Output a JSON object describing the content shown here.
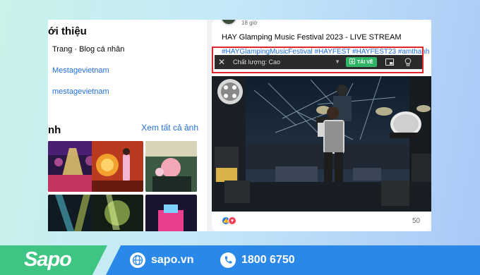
{
  "profile_intro": {
    "title": "ới thiệu",
    "rows": [
      {
        "text": "Trang · Blog cá nhân",
        "type": "text"
      },
      {
        "text": "Mestagevietnam",
        "type": "link"
      },
      {
        "text": "mestagevietnam",
        "type": "link"
      }
    ]
  },
  "photos": {
    "title": "nh",
    "see_all": "Xem tất cả ảnh"
  },
  "post": {
    "time": "18 giờ",
    "title": "HAY Glamping Music Festival 2023 - LIVE STREAM",
    "hashtags": "#HAYGlampingMusicFestival #HAYFEST #HAYFEST23 #amthanh",
    "reaction_count": "50"
  },
  "extension_bar": {
    "close": "✕",
    "quality_label": "Chất lượng: Cao",
    "download_label": "TẢI VỀ"
  },
  "footer": {
    "brand": "Sapo",
    "website": "sapo.vn",
    "hotline": "1800 6750",
    "colors": {
      "brand_green": "#3fc583",
      "blue": "#2a89e8"
    }
  }
}
